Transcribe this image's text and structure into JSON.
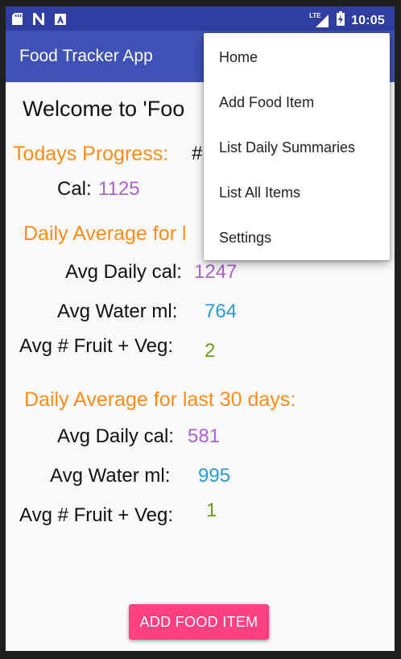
{
  "status_bar": {
    "time": "10:05",
    "network_label": "LTE",
    "icons": [
      "sd-card-icon",
      "n-notification-icon",
      "a-notification-icon",
      "signal-icon",
      "battery-charging-icon"
    ]
  },
  "app_bar": {
    "title": "Food Tracker App"
  },
  "content": {
    "welcome": "Welcome to 'Foo",
    "today": {
      "heading": "Todays Progress:",
      "extra": "#",
      "cal_label": "Cal:",
      "cal_value": "1125"
    },
    "avg7": {
      "heading": "Daily Average for l",
      "daily_cal_label": "Avg Daily cal:",
      "daily_cal_value": "1247",
      "water_label": "Avg Water ml:",
      "water_value": "764",
      "fruit_label": "Avg # Fruit + Veg:",
      "fruit_value": "2"
    },
    "avg30": {
      "heading": "Daily Average for last 30 days:",
      "daily_cal_label": "Avg Daily cal:",
      "daily_cal_value": "581",
      "water_label": "Avg Water ml:",
      "water_value": "995",
      "fruit_label": "Avg # Fruit + Veg:",
      "fruit_value": "1"
    },
    "add_button": "ADD FOOD ITEM"
  },
  "menu": {
    "items": [
      "Home",
      "Add Food Item",
      "List Daily Summaries",
      "List All Items",
      "Settings"
    ]
  },
  "colors": {
    "status_bar": "#2f3e9e",
    "app_bar": "#3f51b5",
    "heading_orange": "#ff8c1a",
    "value_purple": "#ab63cf",
    "value_blue": "#2b9bd1",
    "value_green": "#6a9c22",
    "button_pink": "#ff4081"
  }
}
